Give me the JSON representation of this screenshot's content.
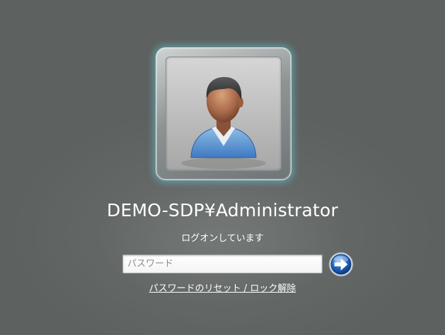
{
  "user": {
    "name": "DEMO-SDP¥Administrator",
    "avatar_icon": "user-avatar-icon"
  },
  "logon": {
    "status": "ログオンしています"
  },
  "password": {
    "value": "",
    "placeholder": "パスワード"
  },
  "submit": {
    "icon": "arrow-right-icon"
  },
  "reset": {
    "label": "パスワードのリセット / ロック解除"
  },
  "colors": {
    "background": "#636766",
    "tile_glow": "#6ec8d7",
    "arrow_button": "#1c5fb8",
    "text": "#ffffff"
  }
}
